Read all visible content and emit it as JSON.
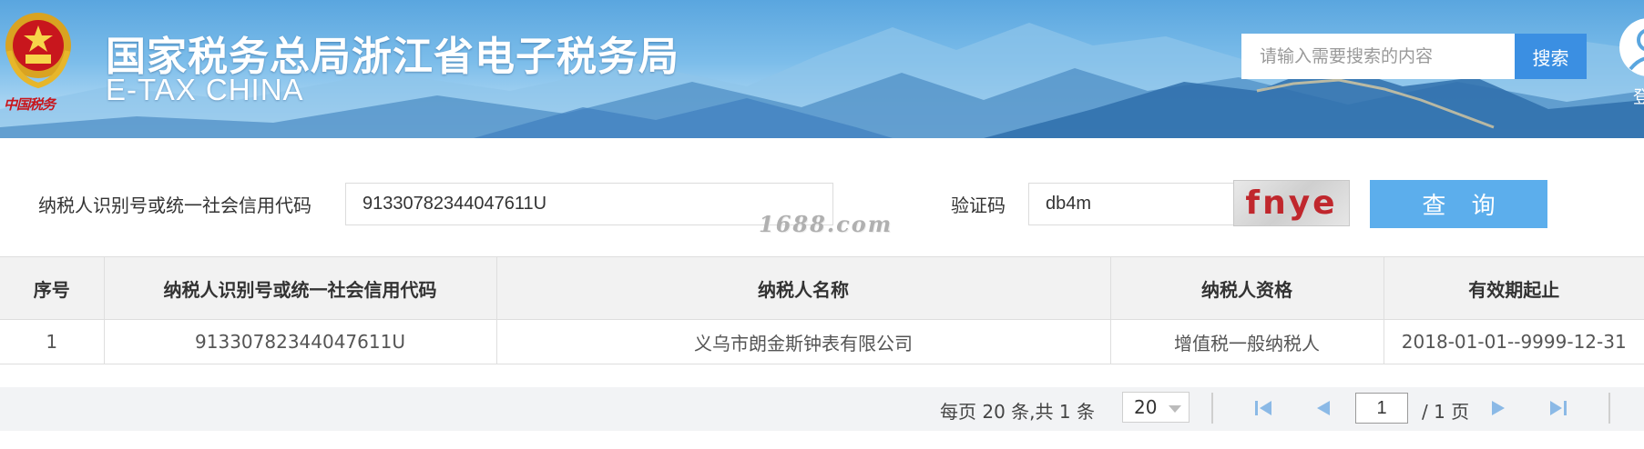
{
  "header": {
    "title": "国家税务总局浙江省电子税务局",
    "subtitle": "E-TAX CHINA",
    "logo_text": "中国税务",
    "search_placeholder": "请输入需要搜索的内容",
    "search_button": "搜索",
    "login_label": "登",
    "colors": {
      "banner_top": "#5aa6df",
      "search_button": "#3b8fe2"
    }
  },
  "form": {
    "taxpayer_id_label": "纳税人识别号或统一社会信用代码",
    "taxpayer_id_value": "91330782344047611U",
    "captcha_label": "验证码",
    "captcha_value": "db4m",
    "captcha_image_text": "fnye",
    "query_button": "查 询",
    "watermark": "1688.com",
    "colors": {
      "query_button": "#5caeec"
    }
  },
  "table": {
    "columns": [
      "序号",
      "纳税人识别号或统一社会信用代码",
      "纳税人名称",
      "纳税人资格",
      "有效期起止"
    ],
    "rows": [
      [
        "1",
        "91330782344047611U",
        "义乌市朗金斯钟表有限公司",
        "增值税一般纳税人",
        "2018-01-01--9999-12-31"
      ]
    ]
  },
  "pagination": {
    "info": "每页 20 条,共 1 条",
    "page_size": "20",
    "current_page": "1",
    "total_pages": "/ 1 页"
  }
}
